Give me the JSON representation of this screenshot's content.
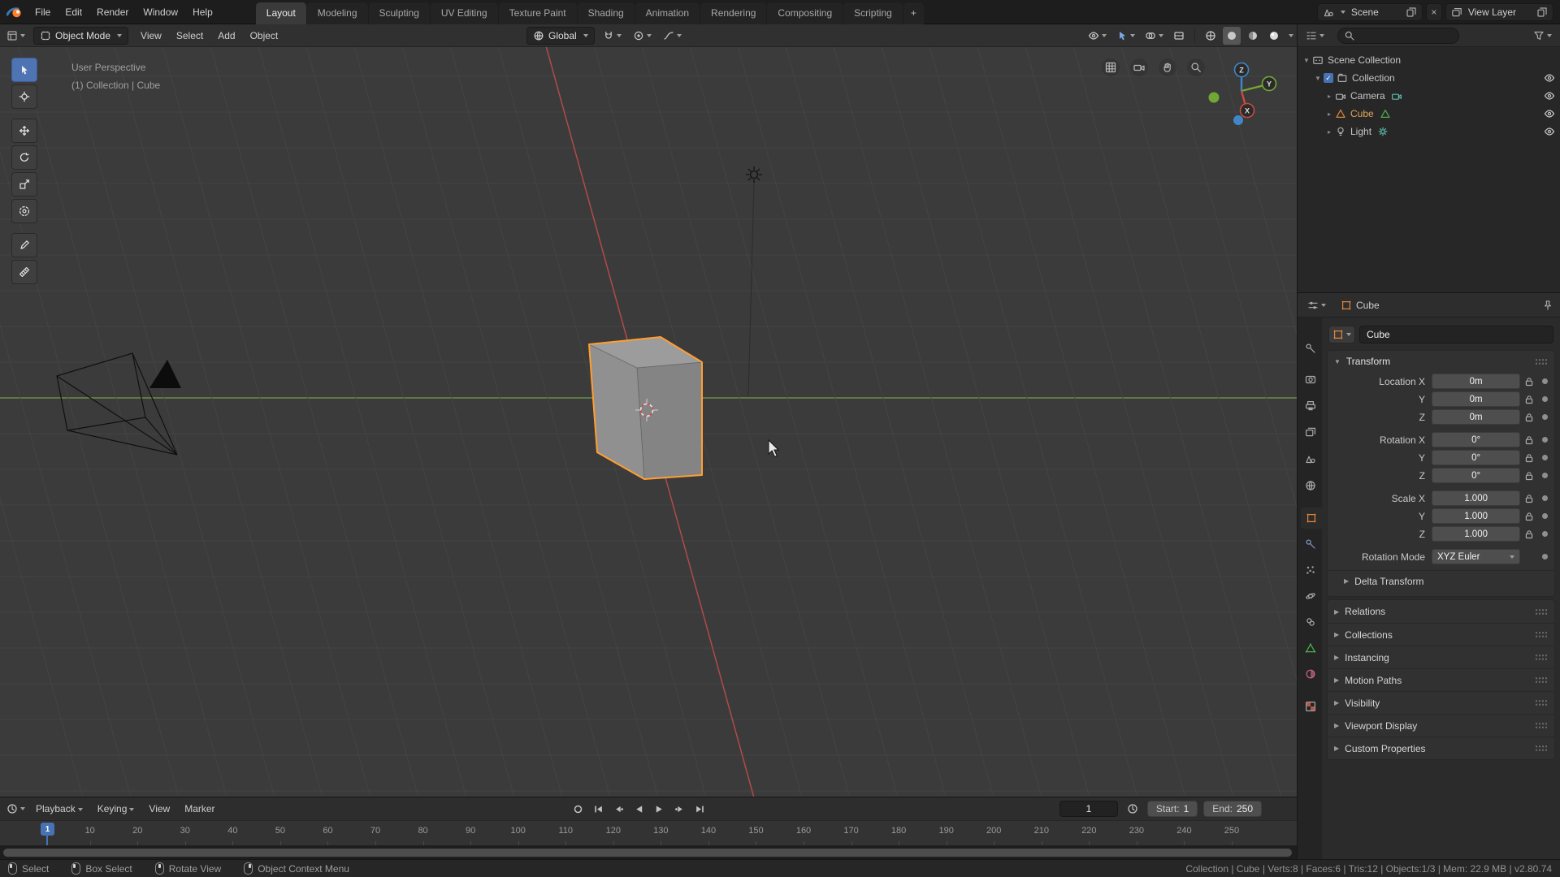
{
  "topbar": {
    "menus": [
      "File",
      "Edit",
      "Render",
      "Window",
      "Help"
    ],
    "workspaces": [
      "Layout",
      "Modeling",
      "Sculpting",
      "UV Editing",
      "Texture Paint",
      "Shading",
      "Animation",
      "Rendering",
      "Compositing",
      "Scripting"
    ],
    "active_workspace": "Layout",
    "new_workspace_label": "+",
    "scene": {
      "label": "Scene"
    },
    "view_layer": {
      "label": "View Layer"
    }
  },
  "viewport": {
    "header": {
      "mode": "Object Mode",
      "menus": [
        "View",
        "Select",
        "Add",
        "Object"
      ],
      "orientation": "Global"
    },
    "tools": [
      {
        "name": "select-box",
        "active": true
      },
      {
        "name": "cursor"
      },
      {
        "name": "move"
      },
      {
        "name": "rotate"
      },
      {
        "name": "scale"
      },
      {
        "name": "transform"
      },
      {
        "name": "annotate"
      },
      {
        "name": "measure"
      }
    ],
    "overlay": {
      "view_label": "User Perspective",
      "context_label": "(1) Collection | Cube"
    },
    "gizmo_axes": {
      "x": "X",
      "y": "Y",
      "z": "Z"
    }
  },
  "outliner": {
    "rows": [
      {
        "label": "Scene Collection",
        "icon": "scene-collection",
        "indent": 0,
        "expander": "open"
      },
      {
        "label": "Collection",
        "icon": "collection",
        "indent": 1,
        "expander": "open",
        "checkbox": true,
        "eye": true
      },
      {
        "label": "Camera",
        "icon": "camera-object",
        "indent": 2,
        "expander": "closed",
        "data_icon": "camera-data",
        "eye": true
      },
      {
        "label": "Cube",
        "icon": "mesh-object",
        "indent": 2,
        "expander": "closed",
        "data_icon": "mesh-data",
        "eye": true,
        "selected": true
      },
      {
        "label": "Light",
        "icon": "light-object",
        "indent": 2,
        "expander": "closed",
        "data_icon": "light-data",
        "eye": true
      }
    ]
  },
  "properties": {
    "tabs": [
      {
        "name": "tool"
      },
      {
        "name": "render"
      },
      {
        "name": "output"
      },
      {
        "name": "view-layer"
      },
      {
        "name": "scene"
      },
      {
        "name": "world"
      },
      {
        "name": "object",
        "active": true
      },
      {
        "name": "modifiers"
      },
      {
        "name": "particles"
      },
      {
        "name": "physics"
      },
      {
        "name": "constraints"
      },
      {
        "name": "object-data"
      },
      {
        "name": "material"
      },
      {
        "name": "texture"
      }
    ],
    "breadcrumb": {
      "object": "Cube"
    },
    "name_field": "Cube",
    "transform": {
      "title": "Transform",
      "rows": [
        {
          "label": "Location X",
          "value": "0m"
        },
        {
          "label": "Y",
          "value": "0m"
        },
        {
          "label": "Z",
          "value": "0m"
        },
        {
          "label": "Rotation X",
          "value": "0°"
        },
        {
          "label": "Y",
          "value": "0°"
        },
        {
          "label": "Z",
          "value": "0°"
        },
        {
          "label": "Scale X",
          "value": "1.000"
        },
        {
          "label": "Y",
          "value": "1.000"
        },
        {
          "label": "Z",
          "value": "1.000"
        }
      ],
      "rotation_mode": {
        "label": "Rotation Mode",
        "value": "XYZ Euler"
      },
      "subpanel": "Delta Transform"
    },
    "panels": [
      "Relations",
      "Collections",
      "Instancing",
      "Motion Paths",
      "Visibility",
      "Viewport Display",
      "Custom Properties"
    ]
  },
  "timeline": {
    "menus": [
      {
        "label": "Playback",
        "caret": true
      },
      {
        "label": "Keying",
        "caret": true
      },
      {
        "label": "View",
        "caret": false
      },
      {
        "label": "Marker",
        "caret": false
      }
    ],
    "current_frame": "1",
    "start": {
      "label": "Start:",
      "value": "1"
    },
    "end": {
      "label": "End:",
      "value": "250"
    },
    "ruler_frames": [
      10,
      20,
      30,
      40,
      50,
      60,
      70,
      80,
      90,
      100,
      110,
      120,
      130,
      140,
      150,
      160,
      170,
      180,
      190,
      200,
      210,
      220,
      230,
      240,
      250
    ]
  },
  "statusbar": {
    "hints": [
      {
        "button": "left",
        "label": "Select"
      },
      {
        "button": "left-drag",
        "label": "Box Select"
      },
      {
        "button": "middle",
        "label": "Rotate View"
      },
      {
        "button": "right",
        "label": "Object Context Menu"
      }
    ],
    "info": "Collection | Cube | Verts:8 | Faces:6 | Tris:12 | Objects:1/3 | Mem: 22.9 MB | v2.80.74"
  },
  "colors": {
    "accent_blue": "#4772b3",
    "selection_orange": "#ff9e33",
    "axis_x_red": "#b14a4a",
    "axis_y_green": "#6d8c46"
  }
}
